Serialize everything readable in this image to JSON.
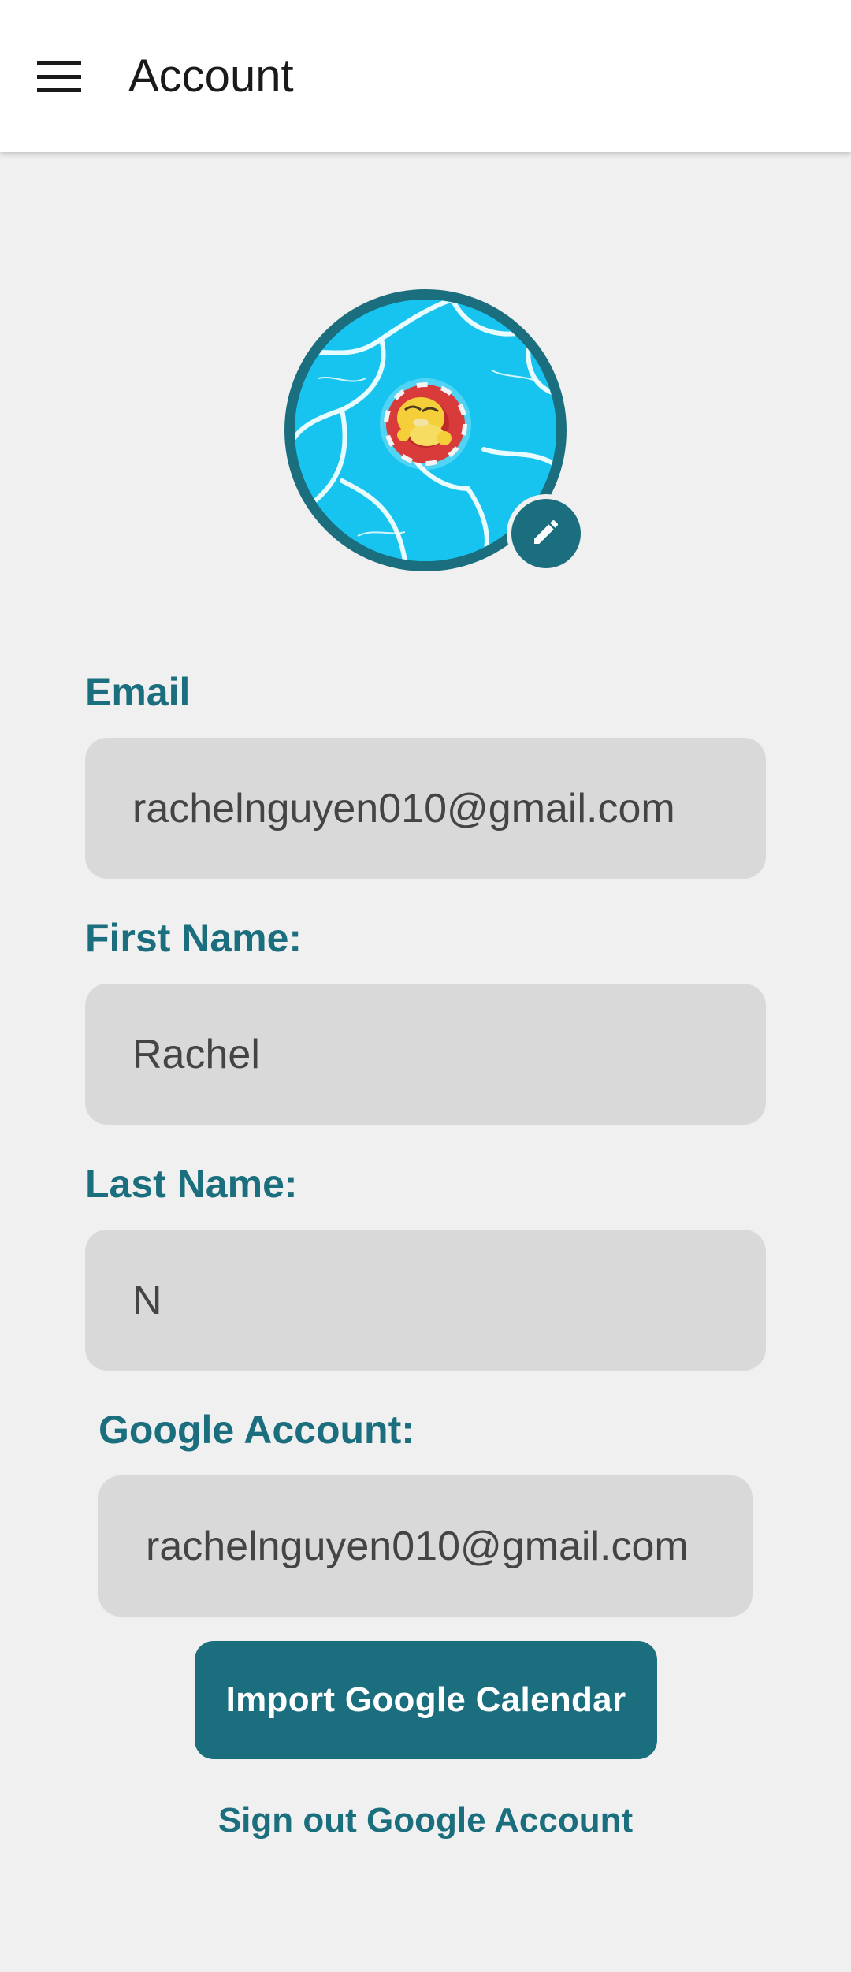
{
  "header": {
    "title": "Account",
    "menu_icon": "hamburger-menu-icon"
  },
  "avatar": {
    "edit_icon": "pencil-icon",
    "border_color": "#1a6e7e",
    "background_color": "#17c4f0"
  },
  "fields": {
    "email": {
      "label": "Email",
      "value": "rachelnguyen010@gmail.com"
    },
    "first_name": {
      "label": "First Name:",
      "value": "Rachel"
    },
    "last_name": {
      "label": "Last Name:",
      "value": "N"
    },
    "google_account": {
      "label": "Google Account:",
      "value": "rachelnguyen010@gmail.com"
    }
  },
  "actions": {
    "import_label": "Import Google Calendar",
    "signout_label": "Sign out Google Account"
  },
  "colors": {
    "accent": "#1a6e7e",
    "background": "#f0f0f0",
    "field_background": "#d9d9d9"
  }
}
